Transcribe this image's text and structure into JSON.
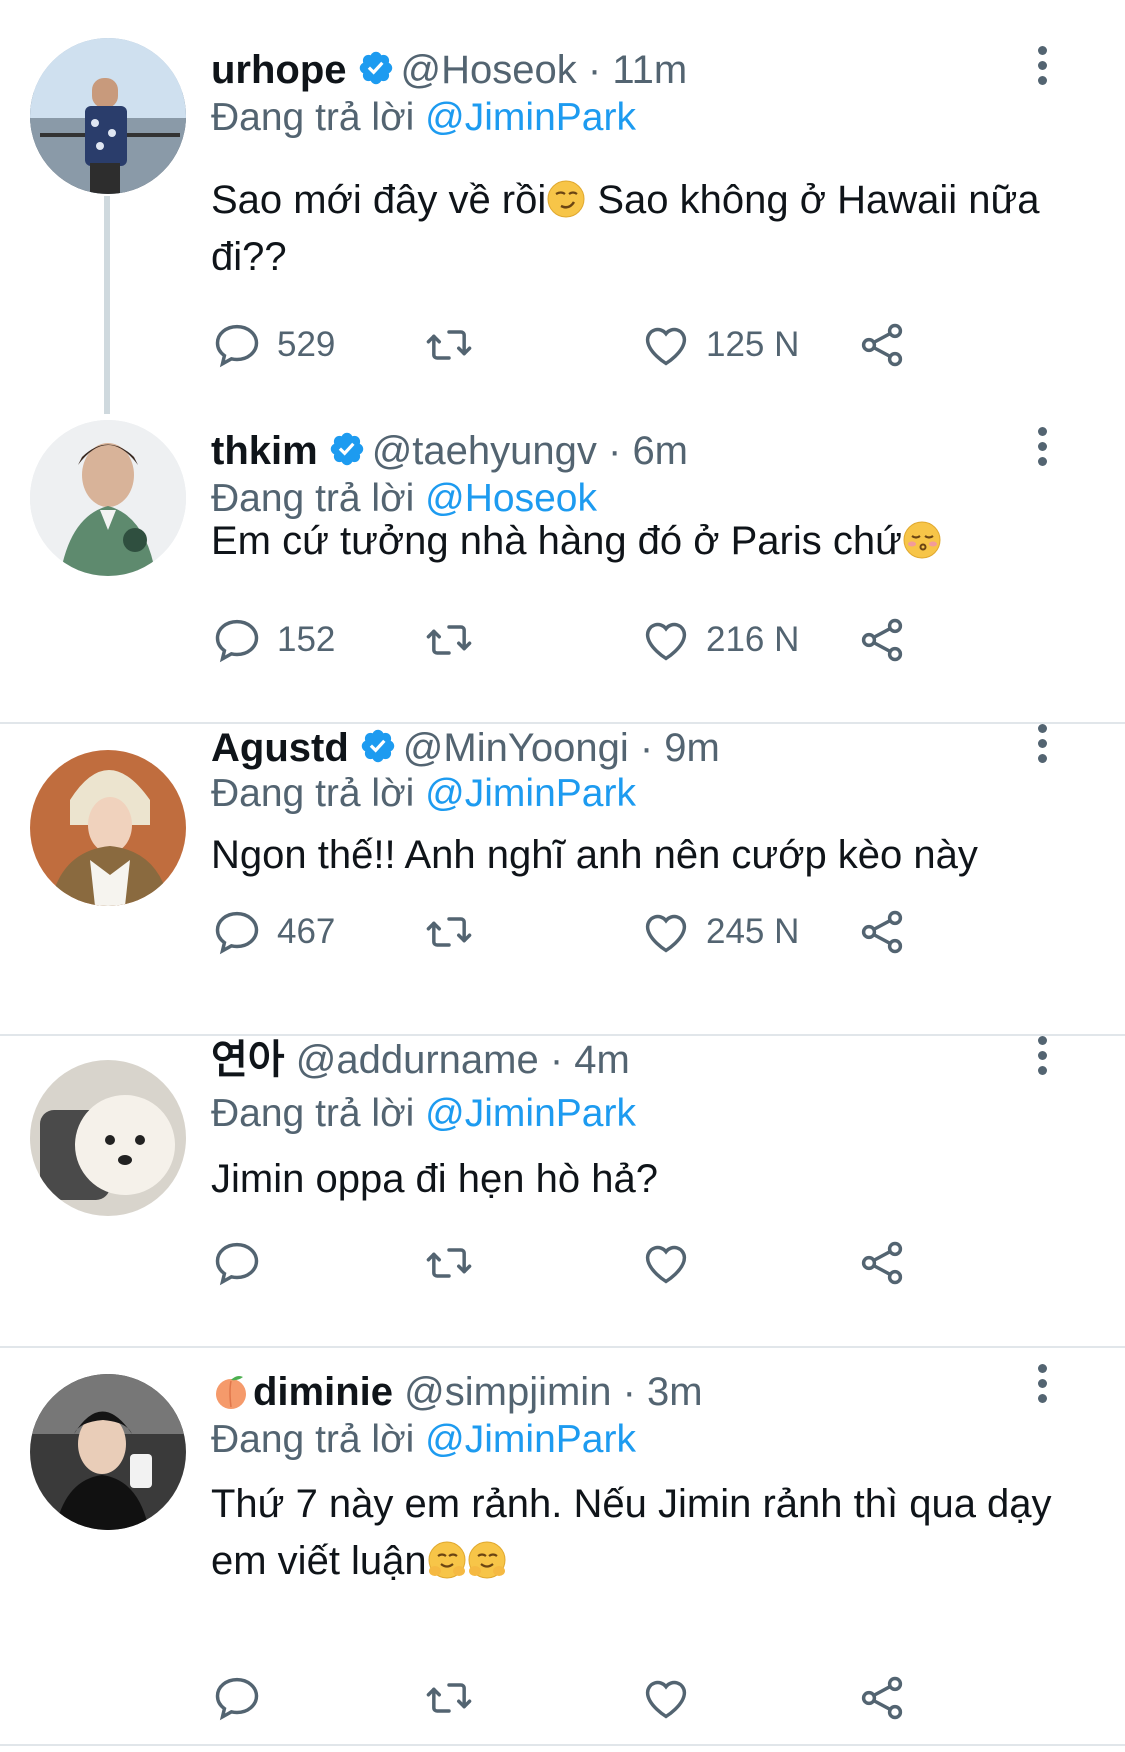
{
  "tweets": [
    {
      "name": "urhope",
      "name_prefix": "",
      "verified": true,
      "handle": "@Hoseok",
      "time": "11m",
      "reply_label": "Đang trả lời",
      "reply_to": "@JiminPark",
      "text_1": "Sao mới đây về rồi",
      "text_2": " Sao không ở Hawaii nữa đi??",
      "replies": "529",
      "likes": "125 N"
    },
    {
      "name": "thkim",
      "name_prefix": "",
      "verified": true,
      "handle": "@taehyungv",
      "time": "6m",
      "reply_label": "Đang trả lời",
      "reply_to": "@Hoseok",
      "text_1": "Em cứ tưởng nhà hàng đó ở Paris chứ",
      "text_2": "",
      "replies": "152",
      "likes": "216 N"
    },
    {
      "name": "Agustd",
      "name_prefix": "",
      "verified": true,
      "handle": "@MinYoongi",
      "time": "9m",
      "reply_label": "Đang trả lời",
      "reply_to": "@JiminPark",
      "text_1": "Ngon thế!! Anh nghĩ anh nên cướp kèo này",
      "text_2": "",
      "replies": "467",
      "likes": "245 N"
    },
    {
      "name": "연아",
      "name_prefix": "",
      "verified": false,
      "handle": "@addurname",
      "time": "4m",
      "reply_label": "Đang trả lời",
      "reply_to": "@JiminPark",
      "text_1": "Jimin oppa đi hẹn hò hả?",
      "text_2": "",
      "replies": "",
      "likes": ""
    },
    {
      "name": "diminie",
      "name_prefix": "peach-emoji",
      "verified": false,
      "handle": "@simpjimin",
      "time": "3m",
      "reply_label": "Đang trả lời",
      "reply_to": "@JiminPark",
      "text_1": "Thứ 7 này em rảnh. Nếu Jimin rảnh thì qua dạy em viết luận",
      "text_2": "",
      "replies": "",
      "likes": ""
    }
  ],
  "icons": [
    "verified-badge-icon",
    "more-options-icon",
    "reply-icon",
    "retweet-icon",
    "like-icon",
    "share-icon",
    "smirk-emoji",
    "kissing-emoji",
    "hug-emoji",
    "peach-emoji"
  ],
  "colors": {
    "accent": "#1d9bf0",
    "muted": "#536471",
    "text": "#0f1419",
    "divider": "#e1e6ea"
  }
}
